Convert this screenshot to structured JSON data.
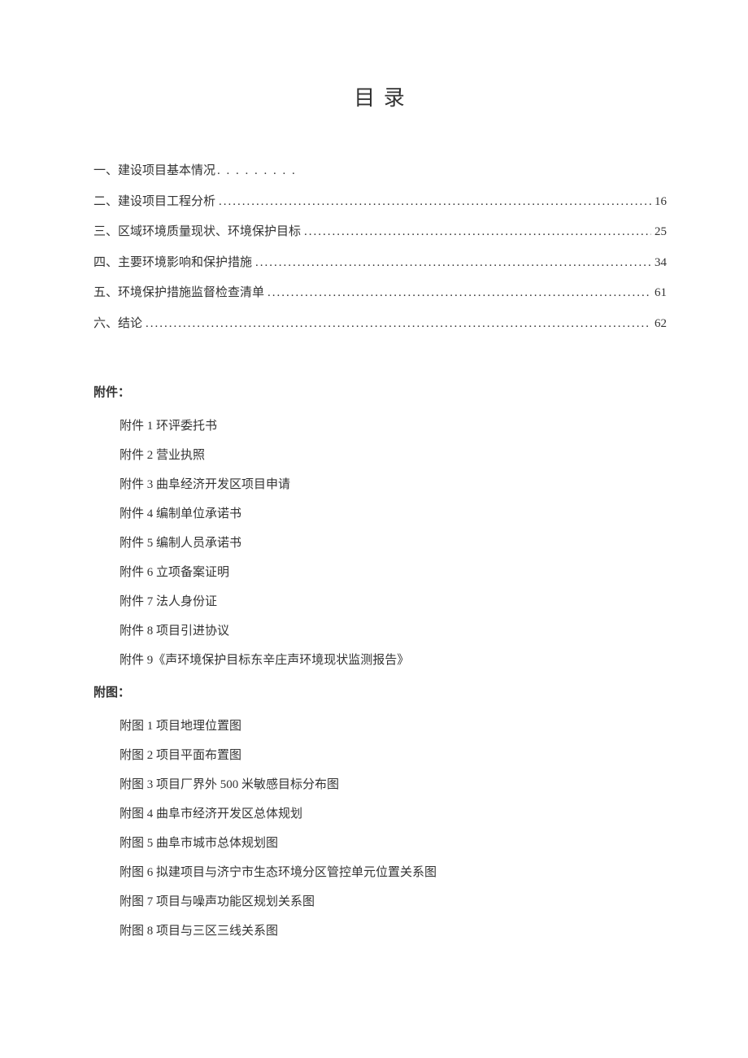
{
  "title": "目 录",
  "toc": [
    {
      "label": "一、建设项目基本情况",
      "page": "",
      "dots": "short"
    },
    {
      "label": "二、建设项目工程分析",
      "page": "16",
      "dots": "full"
    },
    {
      "label": "三、区域环境质量现状、环境保护目标",
      "page": "25",
      "dots": "full"
    },
    {
      "label": "四、主要环境影响和保护措施",
      "page": "34",
      "dots": "full"
    },
    {
      "label": "五、环境保护措施监督检查清单",
      "page": "61",
      "dots": "full"
    },
    {
      "label": "六、结论",
      "page": "62",
      "dots": "full"
    }
  ],
  "attachments": {
    "heading": "附件：",
    "items": [
      "附件 1 环评委托书",
      "附件 2 营业执照",
      "附件 3 曲阜经济开发区项目申请",
      "附件 4 编制单位承诺书",
      "附件 5 编制人员承诺书",
      "附件 6 立项备案证明",
      "附件 7 法人身份证",
      "附件 8 项目引进协议",
      "附件 9《声环境保护目标东辛庄声环境现状监测报告》"
    ]
  },
  "figures": {
    "heading": "附图：",
    "items": [
      "附图 1 项目地理位置图",
      "附图 2 项目平面布置图",
      "附图 3 项目厂界外 500 米敏感目标分布图",
      "附图 4 曲阜市经济开发区总体规划",
      "附图 5 曲阜市城市总体规划图",
      "附图 6 拟建项目与济宁市生态环境分区管控单元位置关系图",
      "附图 7 项目与噪声功能区规划关系图",
      "附图 8 项目与三区三线关系图"
    ]
  }
}
